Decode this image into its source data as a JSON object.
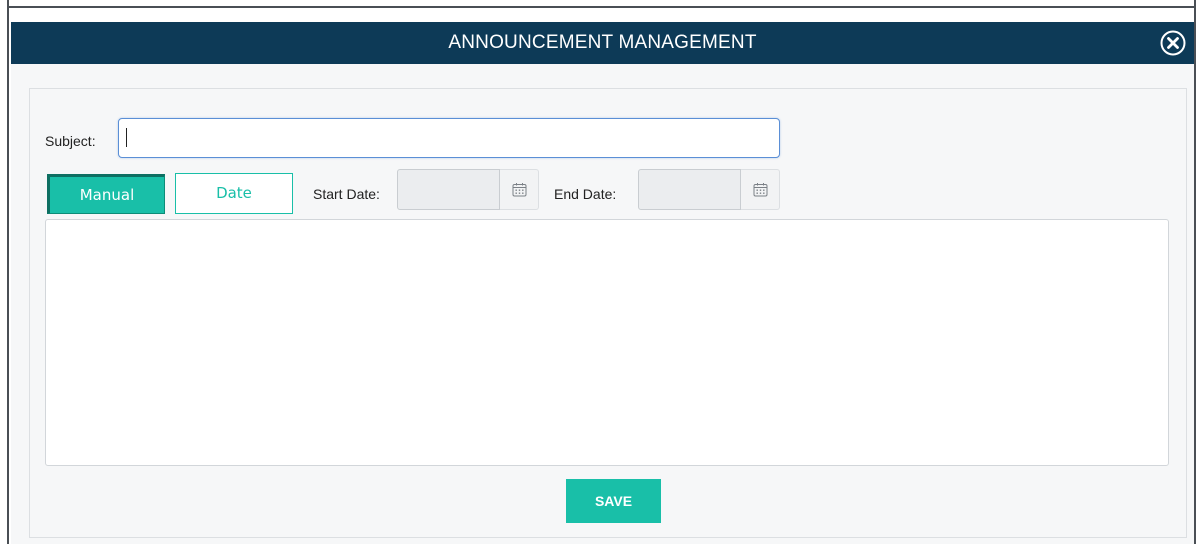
{
  "modal": {
    "title": "ANNOUNCEMENT MANAGEMENT",
    "close_icon": "close-circle-icon"
  },
  "form": {
    "subject_label": "Subject:",
    "subject_value": "",
    "mode_buttons": {
      "manual_label": "Manual",
      "date_label": "Date",
      "selected": "Manual"
    },
    "start_date_label": "Start Date:",
    "start_date_value": "",
    "end_date_label": "End Date:",
    "end_date_value": "",
    "calendar_icon": "calendar-icon",
    "editor_value": "",
    "save_label": "SAVE"
  },
  "colors": {
    "titlebar": "#0d3a57",
    "accent": "#19bfa8",
    "panel_bg": "#f6f7f8"
  }
}
